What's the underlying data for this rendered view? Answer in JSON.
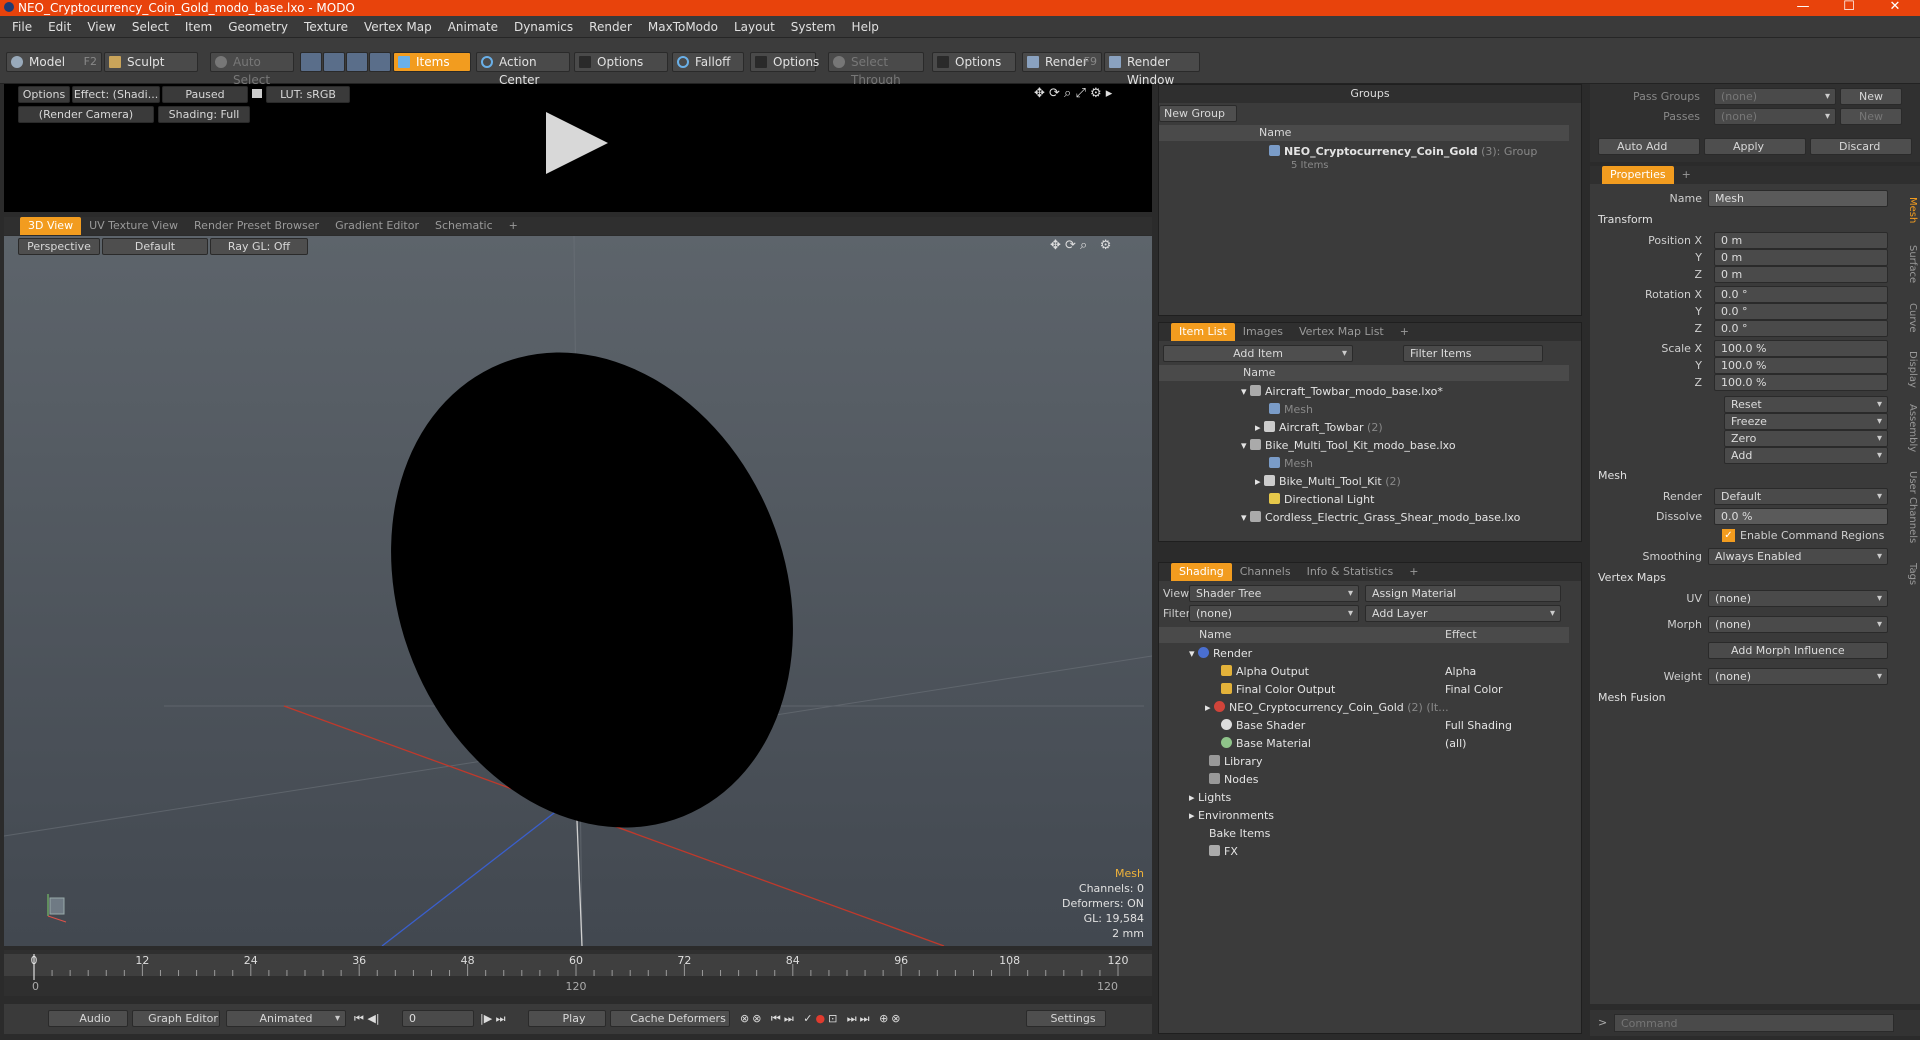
{
  "title": "NEO_Cryptocurrency_Coin_Gold_modo_base.lxo - MODO",
  "window_controls": [
    "—",
    "☐",
    "✕"
  ],
  "menu": [
    "File",
    "Edit",
    "View",
    "Select",
    "Item",
    "Geometry",
    "Texture",
    "Vertex Map",
    "Animate",
    "Dynamics",
    "Render",
    "MaxToModo",
    "Layout",
    "System",
    "Help"
  ],
  "toolbar": {
    "model": "Model",
    "model_key": "F2",
    "sculpt": "Sculpt",
    "auto_select": "Auto Select",
    "items": "Items",
    "action_center": "Action Center",
    "options1": "Options",
    "falloff": "Falloff",
    "options2": "Options",
    "select_through": "Select Through",
    "options3": "Options",
    "render": "Render",
    "render_key": "F9",
    "render_window": "Render Window"
  },
  "preview": {
    "options": "Options",
    "effect": "Effect: (Shadi...",
    "paused": "Paused",
    "lut": "LUT: sRGB",
    "camera": "(Render Camera)",
    "shading": "Shading: Full"
  },
  "viewport_tabs": [
    "3D View",
    "UV Texture View",
    "Render Preset Browser",
    "Gradient Editor",
    "Schematic",
    "+"
  ],
  "viewport": {
    "perspective": "Perspective",
    "default": "Default",
    "raygl": "Ray GL: Off",
    "info_title": "Mesh",
    "channels": "Channels: 0",
    "deformers": "Deformers: ON",
    "gl": "GL: 19,584",
    "scale": "2 mm"
  },
  "timeline": {
    "ticks": [
      "0",
      "12",
      "24",
      "36",
      "48",
      "60",
      "72",
      "84",
      "96",
      "108",
      "120"
    ],
    "sub_start": "0",
    "sub_mid": "120",
    "sub_end": "120"
  },
  "bottom_bar": {
    "audio": "Audio",
    "graph_editor": "Graph Editor",
    "animated": "Animated",
    "frame": "0",
    "play": "Play",
    "cache": "Cache Deformers",
    "settings": "Settings"
  },
  "groups": {
    "title": "Groups",
    "new_group": "New Group",
    "col_name": "Name",
    "item_name": "NEO_Cryptocurrency_Coin_Gold",
    "item_count": "(3)",
    "item_type": ": Group",
    "item_sub": "5 Items"
  },
  "item_list": {
    "tabs": [
      "Item List",
      "Images",
      "Vertex Map List",
      "+"
    ],
    "add_item": "Add Item",
    "filter": "Filter Items",
    "col_name": "Name",
    "rows": [
      {
        "label": "Aircraft_Towbar_modo_base.lxo*"
      },
      {
        "label": "Mesh"
      },
      {
        "label": "Aircraft_Towbar",
        "count": "(2)"
      },
      {
        "label": "Bike_Multi_Tool_Kit_modo_base.lxo"
      },
      {
        "label": "Mesh"
      },
      {
        "label": "Bike_Multi_Tool_Kit",
        "count": "(2)"
      },
      {
        "label": "Directional Light"
      },
      {
        "label": "Cordless_Electric_Grass_Shear_modo_base.lxo"
      }
    ]
  },
  "shading": {
    "tabs": [
      "Shading",
      "Channels",
      "Info & Statistics",
      "+"
    ],
    "view_label": "View",
    "view_value": "Shader Tree",
    "assign_material": "Assign Material",
    "filter_label": "Filter",
    "filter_value": "(none)",
    "add_layer": "Add Layer",
    "col_name": "Name",
    "col_effect": "Effect",
    "rows": [
      {
        "label": "Render",
        "effect": ""
      },
      {
        "label": "Alpha Output",
        "effect": "Alpha"
      },
      {
        "label": "Final Color Output",
        "effect": "Final Color"
      },
      {
        "label": "NEO_Cryptocurrency_Coin_Gold",
        "count": "(2) (It...",
        "effect": ""
      },
      {
        "label": "Base Shader",
        "effect": "Full Shading"
      },
      {
        "label": "Base Material",
        "effect": "(all)"
      },
      {
        "label": "Library",
        "effect": ""
      },
      {
        "label": "Nodes",
        "effect": ""
      },
      {
        "label": "Lights",
        "effect": ""
      },
      {
        "label": "Environments",
        "effect": ""
      },
      {
        "label": "Bake Items",
        "effect": ""
      },
      {
        "label": "FX",
        "effect": ""
      }
    ]
  },
  "passes": {
    "pass_groups": "Pass Groups",
    "pass_value": "(none)",
    "new": "New",
    "passes": "Passes",
    "passes_value": "(none)",
    "new2": "New",
    "auto_add": "Auto Add",
    "apply": "Apply",
    "discard": "Discard"
  },
  "properties": {
    "tab": "Properties",
    "plus": "+",
    "name_label": "Name",
    "name_value": "Mesh",
    "transform": "Transform",
    "position_x": "Position X",
    "pos_x": "0 m",
    "pos_y": "0 m",
    "pos_z": "0 m",
    "rotation_x": "Rotation X",
    "rot_x": "0.0 °",
    "rot_y": "0.0 °",
    "rot_z": "0.0 °",
    "scale_x": "Scale X",
    "scl_x": "100.0 %",
    "scl_y": "100.0 %",
    "scl_z": "100.0 %",
    "y": "Y",
    "z": "Z",
    "reset": "Reset",
    "freeze": "Freeze",
    "zero": "Zero",
    "add": "Add",
    "mesh": "Mesh",
    "render_label": "Render",
    "render_value": "Default",
    "dissolve_label": "Dissolve",
    "dissolve_value": "0.0 %",
    "enable_cmd": "Enable Command Regions",
    "smoothing_label": "Smoothing",
    "smoothing_value": "Always Enabled",
    "vertex_maps": "Vertex Maps",
    "uv_label": "UV",
    "uv_value": "(none)",
    "morph_label": "Morph",
    "morph_value": "(none)",
    "add_morph": "Add Morph Influence",
    "weight_label": "Weight",
    "weight_value": "(none)",
    "mesh_fusion": "Mesh Fusion",
    "side_tabs": [
      "Mesh",
      "Surface",
      "Curve",
      "Display",
      "Assembly",
      "User Channels",
      "Tags"
    ]
  },
  "command": {
    "placeholder": "Command",
    "prompt": ">"
  },
  "colors": {
    "accent": "#f29c1f",
    "titlebar": "#e8430c"
  }
}
